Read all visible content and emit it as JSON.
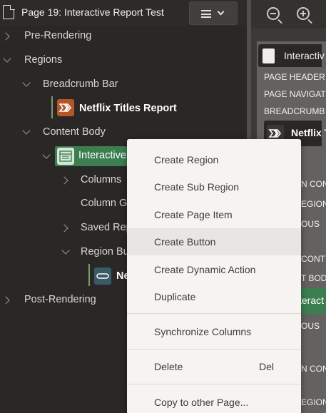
{
  "tree": {
    "page_title": "Page 19: Interactive Report Test",
    "items": [
      {
        "label": "Pre-Rendering"
      },
      {
        "label": "Regions"
      },
      {
        "label": "Breadcrumb Bar"
      },
      {
        "label": "Netflix Titles Report"
      },
      {
        "label": "Content Body"
      },
      {
        "label": "Interactive"
      },
      {
        "label": "Columns"
      },
      {
        "label": "Column G"
      },
      {
        "label": "Saved Rep"
      },
      {
        "label": "Region Bu"
      },
      {
        "label": "Ne"
      },
      {
        "label": "Post-Rendering"
      }
    ]
  },
  "layout_panel": {
    "card_title": "Interactiv",
    "sections": [
      "PAGE HEADER",
      "PAGE NAVIGATI",
      "BREADCRUMB B"
    ],
    "breadcrumb_region": "Netflix T",
    "clipped": [
      "N CONT",
      "EGIONS",
      "OUS",
      "CONTE",
      "T BODY",
      "OUS",
      "N CONT",
      "EGIONS"
    ],
    "green_region": "teract"
  },
  "context_menu": {
    "items": [
      {
        "label": "Create Region"
      },
      {
        "label": "Create Sub Region"
      },
      {
        "label": "Create Page Item"
      },
      {
        "label": "Create Button"
      },
      {
        "label": "Create Dynamic Action"
      },
      {
        "label": "Duplicate"
      },
      {
        "label": "Synchronize Columns"
      },
      {
        "label": "Delete",
        "shortcut": "Del"
      },
      {
        "label": "Copy to other Page..."
      }
    ],
    "highlighted": "Create Button"
  }
}
